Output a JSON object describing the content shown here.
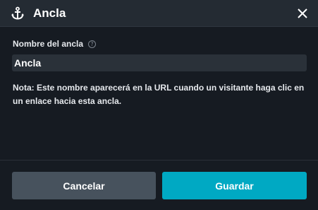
{
  "dialog": {
    "title": "Ancla",
    "icons": {
      "title_icon": "anchor-icon",
      "close": "close-icon",
      "help": "help-icon"
    }
  },
  "form": {
    "label": "Nombre del ancla",
    "help_glyph": "?",
    "value": "Ancla",
    "note": "Nota: Este nombre aparecerá en la URL cuando un visitante haga clic en un enlace hacia esta ancla."
  },
  "buttons": {
    "cancel": "Cancelar",
    "save": "Guardar"
  },
  "colors": {
    "background": "#161b22",
    "header": "#242b33",
    "input": "#2a3139",
    "cancel_button": "#47525d",
    "save_button": "#00a9c3",
    "text": "#ffffff"
  }
}
